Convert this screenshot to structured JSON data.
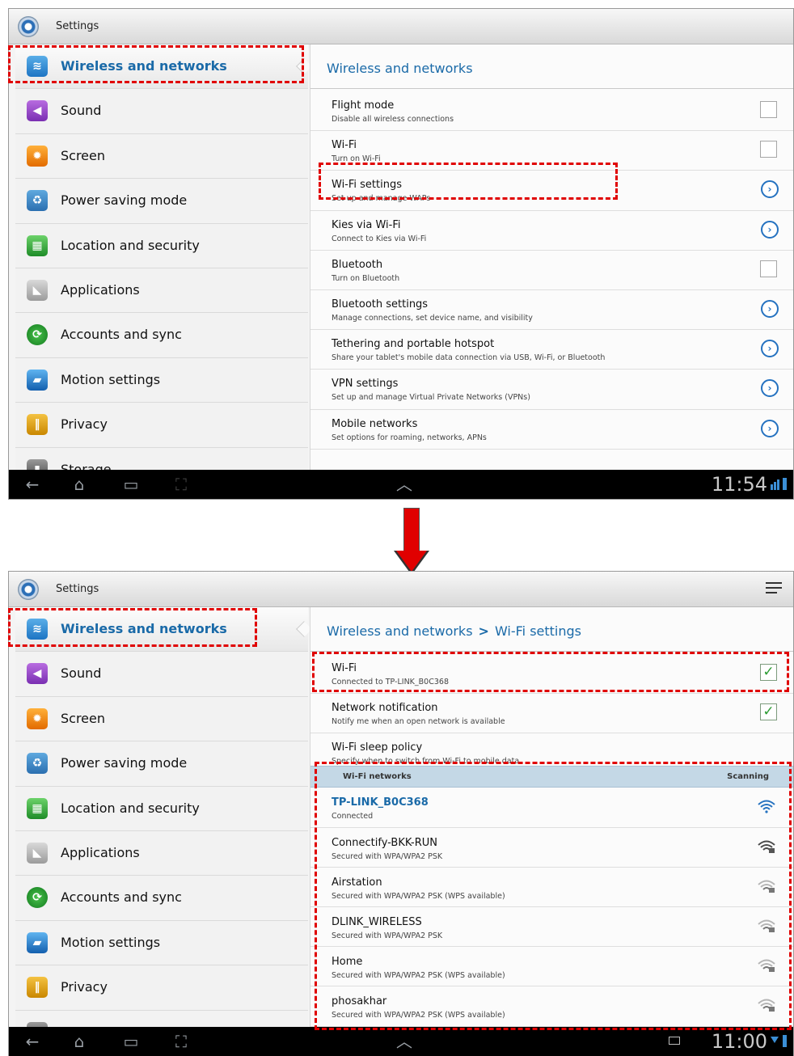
{
  "app": {
    "title": "Settings"
  },
  "sidebar": {
    "items": [
      {
        "label": "Wireless and networks",
        "icon": "wifi-icon"
      },
      {
        "label": "Sound",
        "icon": "speaker-icon"
      },
      {
        "label": "Screen",
        "icon": "brightness-icon"
      },
      {
        "label": "Power saving mode",
        "icon": "battery-recycle-icon"
      },
      {
        "label": "Location and security",
        "icon": "location-grid-icon"
      },
      {
        "label": "Applications",
        "icon": "android-icon"
      },
      {
        "label": "Accounts and sync",
        "icon": "sync-icon"
      },
      {
        "label": "Motion settings",
        "icon": "tablet-motion-icon"
      },
      {
        "label": "Privacy",
        "icon": "fence-icon"
      },
      {
        "label": "Storage",
        "icon": "sd-card-icon"
      }
    ]
  },
  "screen1": {
    "breadcrumb": "Wireless and networks",
    "rows": [
      {
        "title": "Flight mode",
        "subtitle": "Disable all wireless connections",
        "control": "checkbox"
      },
      {
        "title": "Wi-Fi",
        "subtitle": "Turn on Wi-Fi",
        "control": "checkbox"
      },
      {
        "title": "Wi-Fi settings",
        "subtitle": "Set up and manage WAPs",
        "control": "arrow"
      },
      {
        "title": "Kies via Wi-Fi",
        "subtitle": "Connect to Kies via Wi-Fi",
        "control": "arrow"
      },
      {
        "title": "Bluetooth",
        "subtitle": "Turn on Bluetooth",
        "control": "checkbox"
      },
      {
        "title": "Bluetooth settings",
        "subtitle": "Manage connections, set device name, and visibility",
        "control": "arrow"
      },
      {
        "title": "Tethering and portable hotspot",
        "subtitle": "Share your tablet's mobile data connection via USB, Wi-Fi, or Bluetooth",
        "control": "arrow"
      },
      {
        "title": "VPN settings",
        "subtitle": "Set up and manage Virtual Private Networks (VPNs)",
        "control": "arrow"
      },
      {
        "title": "Mobile networks",
        "subtitle": "Set options for roaming, networks, APNs",
        "control": "arrow"
      }
    ],
    "clock": "11:54"
  },
  "screen2": {
    "breadcrumb_parent": "Wireless and networks",
    "breadcrumb_separator": ">",
    "breadcrumb_current": "Wi-Fi settings",
    "rows": [
      {
        "title": "Wi-Fi",
        "subtitle": "Connected to TP-LINK_B0C368",
        "checked": true
      },
      {
        "title": "Network notification",
        "subtitle": "Notify me when an open network is available",
        "checked": true
      },
      {
        "title": "Wi-Fi sleep policy",
        "subtitle": "Specify when to switch from Wi-Fi to mobile data"
      }
    ],
    "networks_header": "Wi-Fi networks",
    "networks_status": "Scanning",
    "networks": [
      {
        "name": "TP-LINK_B0C368",
        "status": "Connected",
        "secured": false,
        "strength": "strong"
      },
      {
        "name": "Connectify-BKK-RUN",
        "status": "Secured with WPA/WPA2 PSK",
        "secured": true,
        "strength": "strong"
      },
      {
        "name": "Airstation",
        "status": "Secured with WPA/WPA2 PSK (WPS available)",
        "secured": true,
        "strength": "weak"
      },
      {
        "name": "DLINK_WIRELESS",
        "status": "Secured with WPA/WPA2 PSK",
        "secured": true,
        "strength": "weak"
      },
      {
        "name": "Home",
        "status": "Secured with WPA/WPA2 PSK (WPS available)",
        "secured": true,
        "strength": "weak"
      },
      {
        "name": "phosakhar",
        "status": "Secured with WPA/WPA2 PSK (WPS available)",
        "secured": true,
        "strength": "weak"
      }
    ],
    "clock": "11:00"
  },
  "colors": {
    "accent": "#1a6aa8",
    "highlight_dash": "#e00000",
    "arrow": "#e00000"
  }
}
